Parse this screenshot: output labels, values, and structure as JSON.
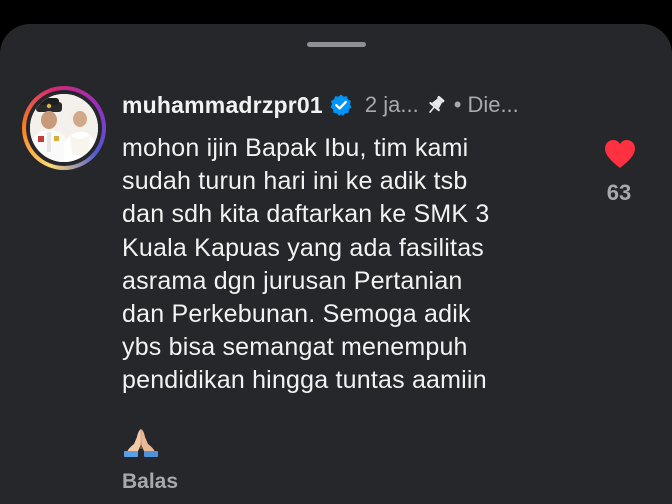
{
  "comment": {
    "username": "muhammadrzpr01",
    "time": "2 ja...",
    "edited": "Die...",
    "body": "mohon ijin Bapak Ibu, tim kami\nsudah turun hari ini ke adik tsb\ndan sdh kita daftarkan ke SMK 3\nKuala Kapuas yang ada fasilitas\nasrama dgn jurusan Pertanian\ndan Perkebunan. Semoga adik\nybs bisa semangat menempuh\npendidikan hingga tuntas aamiin",
    "emoji": "praying-hands",
    "reply_label": "Balas",
    "like_count": "63"
  },
  "colors": {
    "sheet_bg": "#26272b",
    "text_primary": "#f2f2f2",
    "text_secondary": "#a8a8ad",
    "verified_blue": "#0095f6",
    "like_red": "#ff3040"
  },
  "icons": {
    "verified": "verified-badge-icon",
    "pin": "pin-icon",
    "like": "heart-icon"
  }
}
